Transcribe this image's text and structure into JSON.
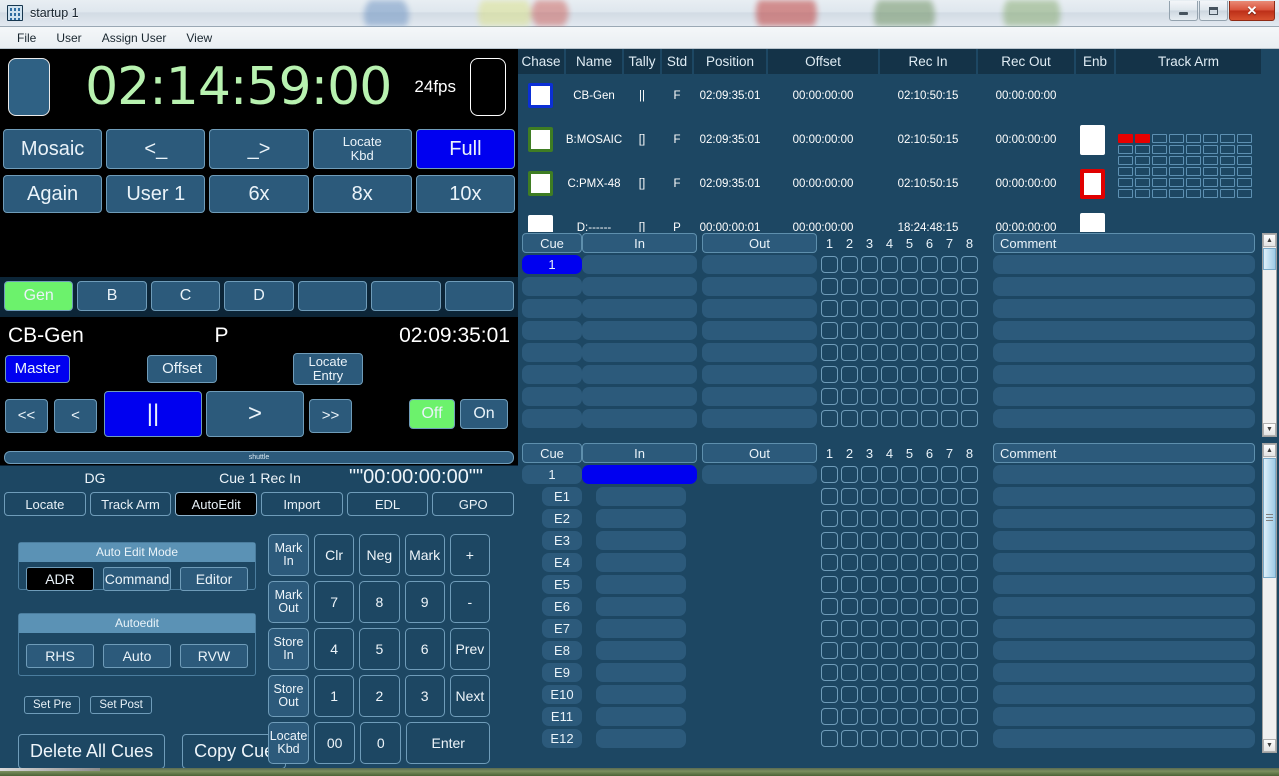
{
  "window": {
    "title": "startup 1",
    "icon": "app-grid-icon",
    "controls": {
      "minimize": "Minimize",
      "maximize": "Maximize",
      "close": "✕"
    }
  },
  "menubar": {
    "items": [
      "File",
      "User",
      "Assign User",
      "View"
    ]
  },
  "timecode": {
    "main": "02:14:59:00",
    "fps": "24fps"
  },
  "function_grid": {
    "row1": [
      "Mosaic",
      "<_",
      "_>",
      "Locate\nKbd",
      "Full"
    ],
    "row2": [
      "Again",
      "User 1",
      "6x",
      "8x",
      "10x"
    ],
    "row1_labels": [
      "Mosaic",
      "<_",
      "_>",
      "Locate Kbd",
      "Full"
    ],
    "active_row1": "Full"
  },
  "machine_select": {
    "buttons": [
      "Gen",
      "B",
      "C",
      "D",
      "",
      "",
      ""
    ],
    "active": "Gen"
  },
  "machine_detail": {
    "name": "CB-Gen",
    "mode": "P",
    "position": "02:09:35:01",
    "master_label": "Master",
    "offset_label": "Offset",
    "locate_entry_label": "Locate\nEntry",
    "transport": {
      "rewind": "<<",
      "step_back": "<",
      "pause": "||",
      "play": ">",
      "forward": ">>",
      "off": "Off",
      "on": "On"
    },
    "shuttle_label": "shuttle"
  },
  "status_bar": {
    "device": "DG",
    "cue_label": "Cue 1  Rec In",
    "timecode": "\"\"00:00:00:00\"\""
  },
  "tabs": {
    "items": [
      "Locate",
      "Track Arm",
      "AutoEdit",
      "Import",
      "EDL",
      "GPO"
    ],
    "active": "AutoEdit"
  },
  "auto_edit": {
    "mode_group_title": "Auto Edit Mode",
    "mode_buttons": [
      "ADR",
      "Command",
      "Editor"
    ],
    "mode_active": "ADR",
    "autoedit_group_title": "Autoedit",
    "autoedit_buttons": [
      "RHS",
      "Auto",
      "RVW"
    ],
    "set_pre": "Set Pre",
    "set_post": "Set Post",
    "delete_all_cues": "Delete All Cues",
    "copy_cue": "Copy Cue"
  },
  "keypad": {
    "rows": [
      [
        {
          "label": "Mark\nIn",
          "kind": "fn"
        },
        {
          "label": "Clr",
          "kind": "n"
        },
        {
          "label": "Neg",
          "kind": "n"
        },
        {
          "label": "Mark",
          "kind": "n"
        },
        {
          "label": "+",
          "kind": "n"
        }
      ],
      [
        {
          "label": "Mark\nOut",
          "kind": "fn"
        },
        {
          "label": "7",
          "kind": "n"
        },
        {
          "label": "8",
          "kind": "n"
        },
        {
          "label": "9",
          "kind": "n"
        },
        {
          "label": "-",
          "kind": "n"
        }
      ],
      [
        {
          "label": "Store\nIn",
          "kind": "fn"
        },
        {
          "label": "4",
          "kind": "n"
        },
        {
          "label": "5",
          "kind": "n"
        },
        {
          "label": "6",
          "kind": "n"
        },
        {
          "label": "Prev",
          "kind": "n"
        }
      ],
      [
        {
          "label": "Store\nOut",
          "kind": "fn"
        },
        {
          "label": "1",
          "kind": "n"
        },
        {
          "label": "2",
          "kind": "n"
        },
        {
          "label": "3",
          "kind": "n"
        },
        {
          "label": "Next",
          "kind": "n"
        }
      ],
      [
        {
          "label": "Locate\nKbd",
          "kind": "fn"
        },
        {
          "label": "00",
          "kind": "n"
        },
        {
          "label": "0",
          "kind": "n"
        },
        {
          "label": "Enter",
          "kind": "wide"
        }
      ]
    ]
  },
  "machine_list": {
    "headers": [
      "Chase",
      "Name",
      "Tally",
      "Std",
      "Position",
      "Offset",
      "Rec In",
      "Rec Out",
      "Enb",
      "Track Arm"
    ],
    "rows": [
      {
        "chase": "checked-blue",
        "name": "CB-Gen",
        "tally": "||",
        "std": "F",
        "position": "02:09:35:01",
        "offset": "00:00:00:00",
        "rec_in": "02:10:50:15",
        "rec_out": "00:00:00:00",
        "enb": "none",
        "track_arm": "none"
      },
      {
        "chase": "checked-green",
        "name": "B:MOSAIC",
        "tally": "[]",
        "std": "F",
        "position": "02:09:35:01",
        "offset": "00:00:00:00",
        "rec_in": "02:10:50:15",
        "rec_out": "00:00:00:00",
        "enb": "plain",
        "track_arm": "none"
      },
      {
        "chase": "checked-green",
        "name": "C:PMX-48",
        "tally": "[]",
        "std": "F",
        "position": "02:09:35:01",
        "offset": "00:00:00:00",
        "rec_in": "02:10:50:15",
        "rec_out": "00:00:00:00",
        "enb": "red",
        "track_arm": "matrix"
      },
      {
        "chase": "plain",
        "name": "D:------",
        "tally": "[]",
        "std": "P",
        "position": "00:00:00:01",
        "offset": "00:00:00:00",
        "rec_in": "18:24:48:15",
        "rec_out": "00:00:00:00",
        "enb": "plain",
        "track_arm": "none"
      }
    ],
    "track_arm_matrix": {
      "columns": 8,
      "rows": 6,
      "armed_cells": [
        [
          0,
          0
        ],
        [
          0,
          1
        ]
      ],
      "armed_color": "#e60000"
    }
  },
  "cue_list_top": {
    "headers": [
      "Cue",
      "In",
      "Out",
      "Comment"
    ],
    "track_numbers": [
      "1",
      "2",
      "3",
      "4",
      "5",
      "6",
      "7",
      "8"
    ],
    "rows": [
      {
        "cue": "1",
        "in": "",
        "out": "",
        "comment": "",
        "selected": true
      },
      {
        "cue": "",
        "in": "",
        "out": "",
        "comment": "",
        "selected": false
      },
      {
        "cue": "",
        "in": "",
        "out": "",
        "comment": "",
        "selected": false
      },
      {
        "cue": "",
        "in": "",
        "out": "",
        "comment": "",
        "selected": false
      },
      {
        "cue": "",
        "in": "",
        "out": "",
        "comment": "",
        "selected": false
      },
      {
        "cue": "",
        "in": "",
        "out": "",
        "comment": "",
        "selected": false
      },
      {
        "cue": "",
        "in": "",
        "out": "",
        "comment": "",
        "selected": false
      },
      {
        "cue": "",
        "in": "",
        "out": "",
        "comment": "",
        "selected": false
      }
    ]
  },
  "cue_list_bottom": {
    "headers": [
      "Cue",
      "In",
      "Out",
      "Comment"
    ],
    "track_numbers": [
      "1",
      "2",
      "3",
      "4",
      "5",
      "6",
      "7",
      "8"
    ],
    "rows": [
      {
        "cue": "1",
        "in": "",
        "out": "",
        "comment": "",
        "indent": false,
        "in_highlight": true
      },
      {
        "cue": "E1",
        "in": "",
        "out": "",
        "comment": "",
        "indent": true,
        "in_highlight": false
      },
      {
        "cue": "E2",
        "in": "",
        "out": "",
        "comment": "",
        "indent": true,
        "in_highlight": false
      },
      {
        "cue": "E3",
        "in": "",
        "out": "",
        "comment": "",
        "indent": true,
        "in_highlight": false
      },
      {
        "cue": "E4",
        "in": "",
        "out": "",
        "comment": "",
        "indent": true,
        "in_highlight": false
      },
      {
        "cue": "E5",
        "in": "",
        "out": "",
        "comment": "",
        "indent": true,
        "in_highlight": false
      },
      {
        "cue": "E6",
        "in": "",
        "out": "",
        "comment": "",
        "indent": true,
        "in_highlight": false
      },
      {
        "cue": "E7",
        "in": "",
        "out": "",
        "comment": "",
        "indent": true,
        "in_highlight": false
      },
      {
        "cue": "E8",
        "in": "",
        "out": "",
        "comment": "",
        "indent": true,
        "in_highlight": false
      },
      {
        "cue": "E9",
        "in": "",
        "out": "",
        "comment": "",
        "indent": true,
        "in_highlight": false
      },
      {
        "cue": "E10",
        "in": "",
        "out": "",
        "comment": "",
        "indent": true,
        "in_highlight": false
      },
      {
        "cue": "E11",
        "in": "",
        "out": "",
        "comment": "",
        "indent": true,
        "in_highlight": false
      },
      {
        "cue": "E12",
        "in": "",
        "out": "",
        "comment": "",
        "indent": true,
        "in_highlight": false
      }
    ]
  },
  "colors": {
    "background": "#1d4763",
    "panel_black": "#000000",
    "button": "#2c5a7b",
    "button_border": "#6f9cb9",
    "accent_blue": "#0000f0",
    "accent_green": "#6cf26c",
    "accent_red": "#e60000",
    "timecode_green": "#b8f2b0",
    "group_title": "#5b92b5"
  }
}
